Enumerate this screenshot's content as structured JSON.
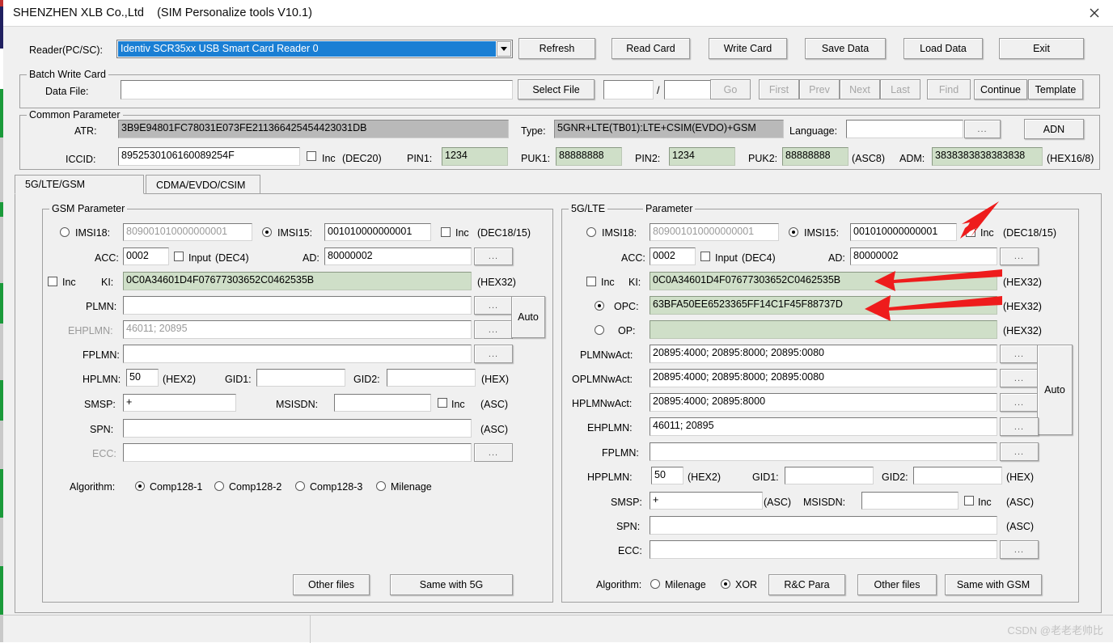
{
  "window": {
    "title": "SHENZHEN XLB Co.,Ltd    (SIM Personalize tools V10.1)",
    "close_label": "✕"
  },
  "toolbar": {
    "reader_label": "Reader(PC/SC):",
    "reader_value": "Identiv SCR35xx USB Smart Card Reader 0",
    "buttons": [
      {
        "label": "Refresh",
        "enabled": true
      },
      {
        "label": "Read Card",
        "enabled": true
      },
      {
        "label": "Write Card",
        "enabled": true
      },
      {
        "label": "Save Data",
        "enabled": true
      },
      {
        "label": "Load Data",
        "enabled": true
      },
      {
        "label": "Exit",
        "enabled": true
      }
    ]
  },
  "batch": {
    "group_label": "Batch Write Card",
    "data_file_label": "Data File:",
    "data_file_value": "",
    "select_file_label": "Select File",
    "index_value": "",
    "total_value": "",
    "separator": "/",
    "buttons": [
      {
        "label": "Go",
        "enabled": false
      },
      {
        "label": "First",
        "enabled": false
      },
      {
        "label": "Prev",
        "enabled": false
      },
      {
        "label": "Next",
        "enabled": false
      },
      {
        "label": "Last",
        "enabled": false
      },
      {
        "label": "Find",
        "enabled": false
      },
      {
        "label": "Continue",
        "enabled": true
      },
      {
        "label": "Template",
        "enabled": true
      }
    ]
  },
  "common": {
    "group_label": "Common Parameter",
    "atr_label": "ATR:",
    "atr_value": "3B9E94801FC78031E073FE211366425454423031DB",
    "type_label": "Type:",
    "type_value": "5GNR+LTE(TB01):LTE+CSIM(EVDO)+GSM",
    "language_label": "Language:",
    "language_value": "",
    "language_dots": "...",
    "adn_label": "ADN",
    "iccid_label": "ICCID:",
    "iccid_value": "8952530106160089254F",
    "inc_label": "Inc",
    "dec20_label": "(DEC20)",
    "pin1_label": "PIN1:",
    "pin1_value": "1234",
    "puk1_label": "PUK1:",
    "puk1_value": "88888888",
    "pin2_label": "PIN2:",
    "pin2_value": "1234",
    "puk2_label": "PUK2:",
    "puk2_value": "88888888",
    "asc8_label": "(ASC8)",
    "adm_label": "ADM:",
    "adm_value": "3838383838383838",
    "hex168_label": "(HEX16/8)"
  },
  "tabs": [
    {
      "label": "5G/LTE/GSM",
      "active": true
    },
    {
      "label": "CDMA/EVDO/CSIM",
      "active": false
    }
  ],
  "gsm": {
    "group_label": "GSM Parameter",
    "imsi18_label": "IMSI18:",
    "imsi18_value": "809001010000000001",
    "imsi18_selected": false,
    "imsi15_label": "IMSI15:",
    "imsi15_value": "001010000000001",
    "imsi15_selected": true,
    "inc_label": "Inc",
    "dec1815_label": "(DEC18/15)",
    "acc_label": "ACC:",
    "acc_value": "0002",
    "input_label": "Input",
    "dec4_label": "(DEC4)",
    "ad_label": "AD:",
    "ad_value": "80000002",
    "ki_inc_label": "Inc",
    "ki_label": "KI:",
    "ki_value": "0C0A34601D4F07677303652C0462535B",
    "hex32_label": "(HEX32)",
    "plmn_label": "PLMN:",
    "plmn_value": "",
    "ehplmn_label": "EHPLMN:",
    "ehplmn_value": "46011; 20895",
    "fplmn_label": "FPLMN:",
    "fplmn_value": "",
    "auto_label": "Auto",
    "hplmn_label": "HPLMN:",
    "hplmn_value": "50",
    "hex2_label": "(HEX2)",
    "gid1_label": "GID1:",
    "gid1_value": "",
    "gid2_label": "GID2:",
    "gid2_value": "",
    "hex_label": "(HEX)",
    "smsp_label": "SMSP:",
    "smsp_value": "+",
    "msisdn_label": "MSISDN:",
    "msisdn_value": "",
    "msisdn_inc_label": "Inc",
    "asc_label": "(ASC)",
    "spn_label": "SPN:",
    "spn_value": "",
    "ecc_label": "ECC:",
    "ecc_value": "",
    "algorithm_label": "Algorithm:",
    "algorithms": [
      {
        "label": "Comp128-1",
        "selected": true
      },
      {
        "label": "Comp128-2",
        "selected": false
      },
      {
        "label": "Comp128-3",
        "selected": false
      },
      {
        "label": "Milenage",
        "selected": false
      }
    ],
    "other_files_label": "Other files",
    "same_with_5g_label": "Same with 5G",
    "dots": "..."
  },
  "lte": {
    "group_label": "5G/LTE      Parameter",
    "group_label_left": "5G/LTE",
    "group_label_right": "Parameter",
    "imsi18_label": "IMSI18:",
    "imsi18_value": "809001010000000001",
    "imsi18_selected": false,
    "imsi15_label": "IMSI15:",
    "imsi15_value": "001010000000001",
    "imsi15_selected": true,
    "inc_label": "Inc",
    "dec1815_label": "(DEC18/15)",
    "acc_label": "ACC:",
    "acc_value": "0002",
    "input_label": "Input",
    "dec4_label": "(DEC4)",
    "ad_label": "AD:",
    "ad_value": "80000002",
    "ki_inc_label": "Inc",
    "ki_label": "KI:",
    "ki_value": "0C0A34601D4F07677303652C0462535B",
    "hex32_label": "(HEX32)",
    "opc_label": "OPC:",
    "opc_value": "63BFA50EE6523365FF14C1F45F88737D",
    "opc_selected": true,
    "op_label": "OP:",
    "op_value": "",
    "op_selected": false,
    "plmnwact_label": "PLMNwAct:",
    "plmnwact_value": "20895:4000; 20895:8000; 20895:0080",
    "oplmnwact_label": "OPLMNwAct:",
    "oplmnwact_value": "20895:4000; 20895:8000; 20895:0080",
    "hplmnwact_label": "HPLMNwAct:",
    "hplmnwact_value": "20895:4000; 20895:8000",
    "ehplmn_label": "EHPLMN:",
    "ehplmn_value": "46011; 20895",
    "fplmn_label": "FPLMN:",
    "fplmn_value": "",
    "auto_label": "Auto",
    "hpplmn_label": "HPPLMN:",
    "hpplmn_value": "50",
    "hex2_label": "(HEX2)",
    "gid1_label": "GID1:",
    "gid1_value": "",
    "gid2_label": "GID2:",
    "gid2_value": "",
    "hex_label": "(HEX)",
    "smsp_label": "SMSP:",
    "smsp_value": "+",
    "asc_label": "(ASC)",
    "msisdn_label": "MSISDN:",
    "msisdn_value": "",
    "msisdn_inc_label": "Inc",
    "spn_label": "SPN:",
    "spn_value": "",
    "ecc_label": "ECC:",
    "ecc_value": "",
    "algorithm_label": "Algorithm:",
    "algorithms": [
      {
        "label": "Milenage",
        "selected": false
      },
      {
        "label": "XOR",
        "selected": true
      }
    ],
    "rc_para_label": "R&C Para",
    "other_files_label": "Other files",
    "same_with_gsm_label": "Same with GSM",
    "dots": "..."
  },
  "status": {
    "watermark": "CSDN @老老老帅比"
  }
}
